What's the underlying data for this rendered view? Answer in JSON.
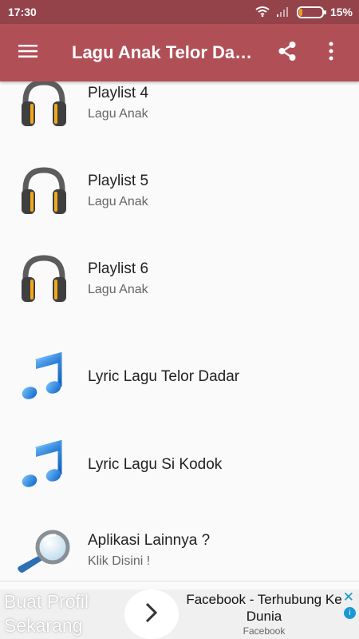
{
  "status_bar": {
    "time": "17:30",
    "battery_percent": "15%",
    "battery_level": 0.15
  },
  "app_bar": {
    "title": "Lagu Anak Telor Dadar",
    "icons": [
      "menu-icon",
      "share-icon",
      "more-vertical-icon"
    ]
  },
  "list": {
    "items": [
      {
        "title": "Playlist 4",
        "subtitle": "Lagu Anak",
        "icon": "headphones-icon"
      },
      {
        "title": "Playlist 5",
        "subtitle": "Lagu Anak",
        "icon": "headphones-icon"
      },
      {
        "title": "Playlist 6",
        "subtitle": "Lagu Anak",
        "icon": "headphones-icon"
      },
      {
        "title": "Lyric Lagu Telor Dadar",
        "icon": "music-note-icon"
      },
      {
        "title": "Lyric Lagu Si Kodok",
        "icon": "music-note-icon"
      },
      {
        "title": "Aplikasi Lainnya ?",
        "subtitle": "Klik Disini !",
        "icon": "magnifier-icon"
      }
    ]
  },
  "ad": {
    "left_text_line1": "Buat Profil",
    "left_text_line2": "Sekarang",
    "title": "Facebook - Terhubung Ke Dunia",
    "source": "Facebook",
    "close_symbol": "✕",
    "info_symbol": "i"
  },
  "colors": {
    "status_bar": "#94434a",
    "app_bar": "#b14f57",
    "ad_accent": "#1a98d4"
  }
}
